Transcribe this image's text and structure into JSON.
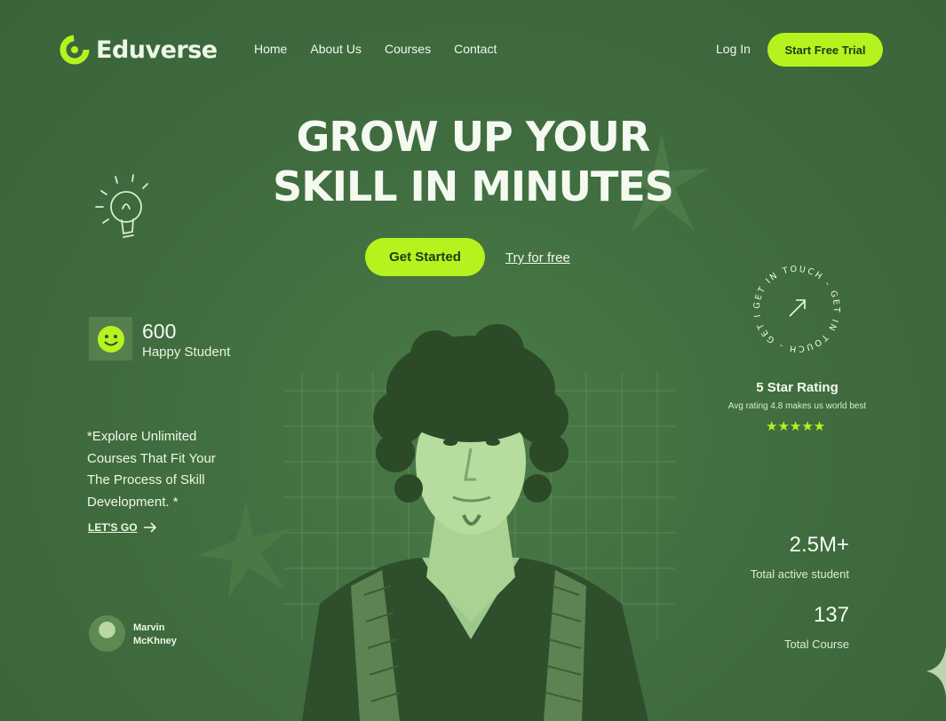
{
  "brand": {
    "name": "Eduverse"
  },
  "nav": {
    "items": [
      {
        "label": "Home"
      },
      {
        "label": "About Us"
      },
      {
        "label": "Courses"
      },
      {
        "label": "Contact"
      }
    ],
    "login_label": "Log In",
    "trial_label": "Start Free Trial"
  },
  "hero": {
    "title_line1": "GROW UP YOUR",
    "title_line2": "SKILL IN MINUTES",
    "primary_cta": "Get Started",
    "secondary_cta": "Try for free"
  },
  "stats_left": {
    "happy_count": "600",
    "happy_label": "Happy Student",
    "explore_text": "*Explore Unlimited Courses That Fit Your The Process of Skill Development. *",
    "lets_go": "LET'S GO"
  },
  "instructor": {
    "name": "Marvin McKhney"
  },
  "touch_badge": {
    "text": "GET IN TOUCH - GET IN TOUCH - GET IN TOUCH -"
  },
  "rating": {
    "title": "5 Star Rating",
    "subtitle": "Avg rating 4.8 makes us world best",
    "stars": "★★★★★",
    "value": 5
  },
  "stats_right": {
    "active_value": "2.5M+",
    "active_label": "Total active student",
    "course_value": "137",
    "course_label": "Total Course"
  },
  "colors": {
    "background": "#3f6b3f",
    "accent": "#b6f21e",
    "text": "#f4faf0"
  },
  "icons": [
    "logo-icon",
    "lightbulb-icon",
    "smiley-icon",
    "arrow-right-icon",
    "arrow-up-right-icon",
    "star-icon",
    "sparkle-icon"
  ]
}
